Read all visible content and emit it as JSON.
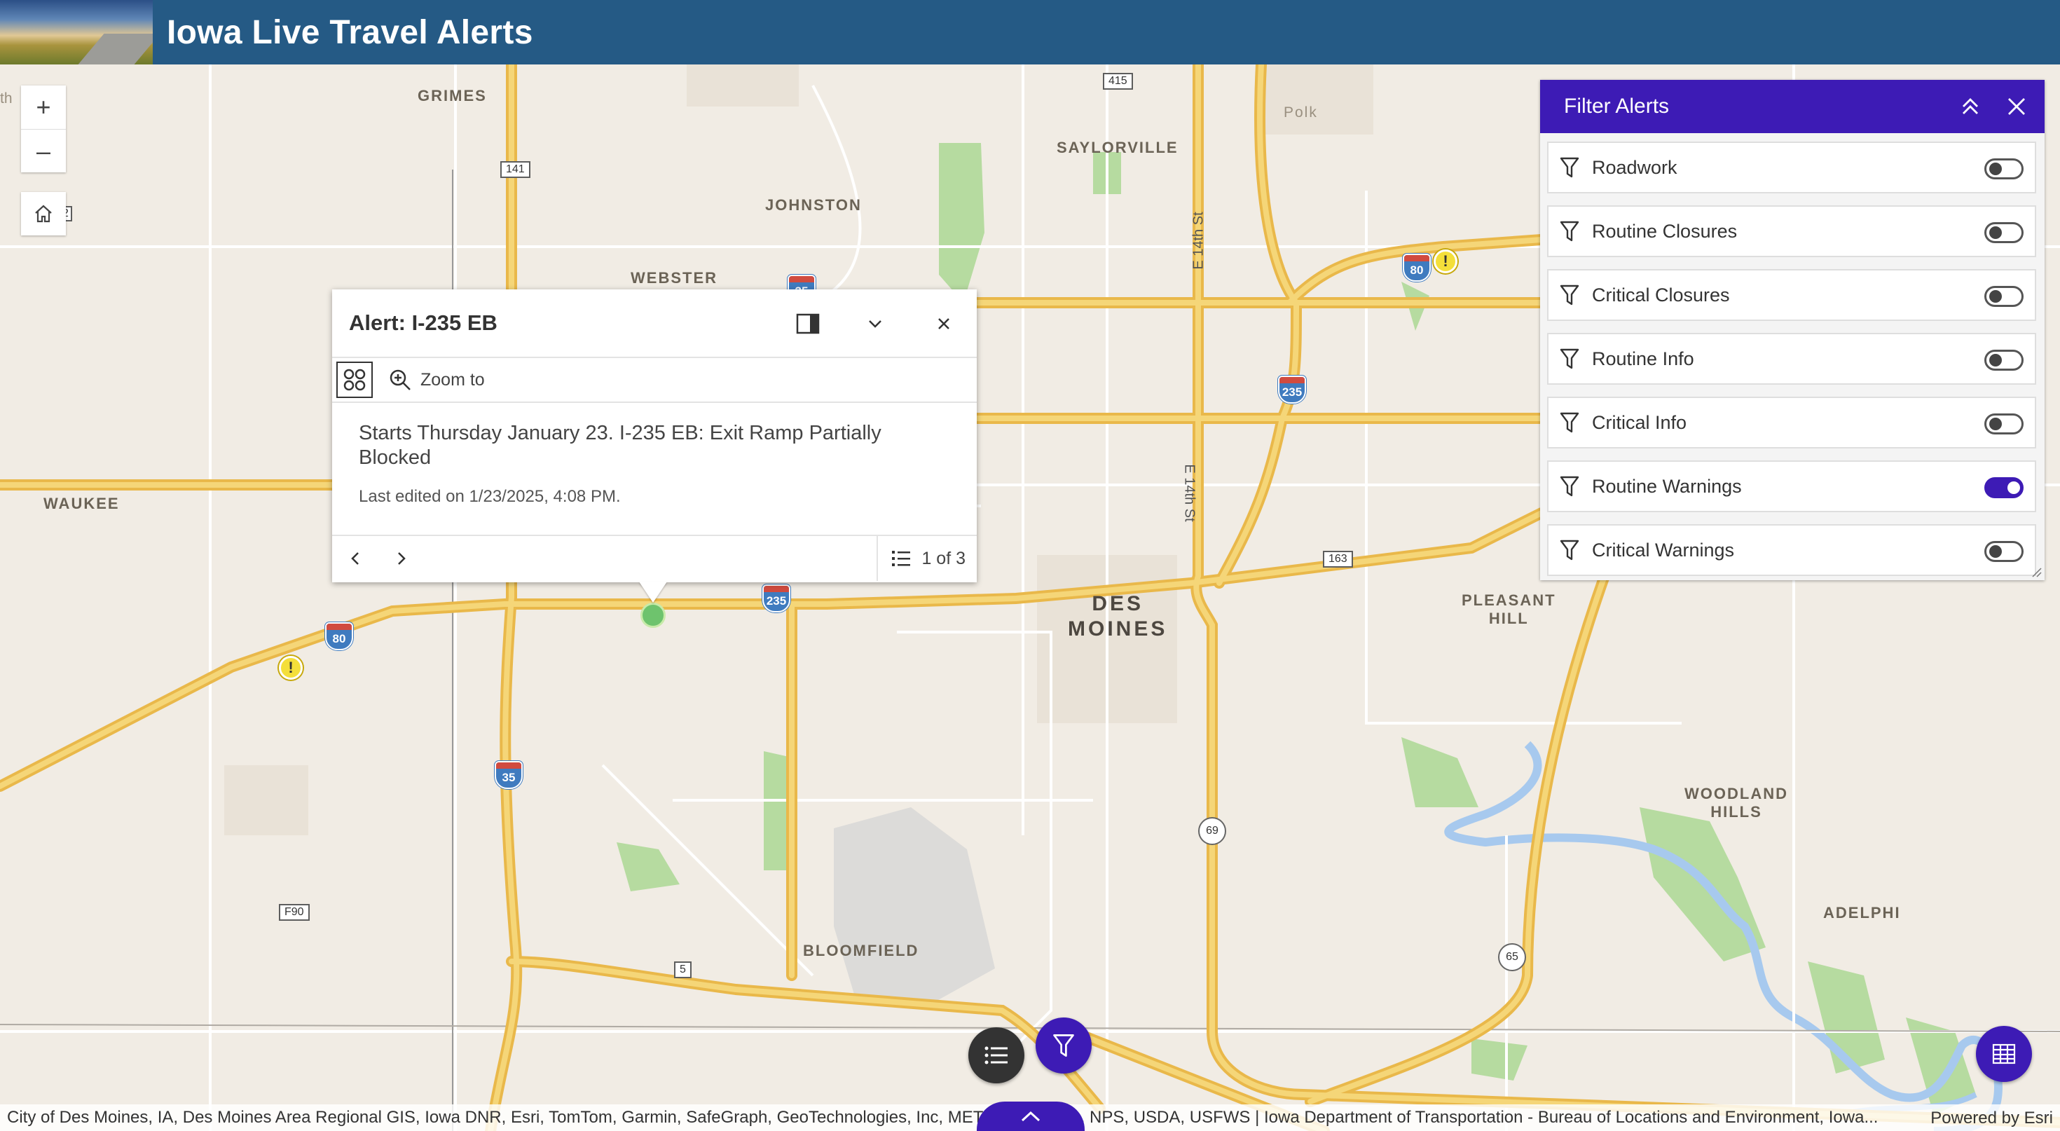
{
  "header": {
    "title": "Iowa Live Travel Alerts"
  },
  "map": {
    "places": {
      "grimes": "GRIMES",
      "saylorville": "SAYLORVILLE",
      "johnston": "JOHNSTON",
      "webster": "WEBSTER",
      "waukee": "WAUKEE",
      "des_moines": "DES\nMOINES",
      "pleasant_hill": "PLEASANT\nHILL",
      "woodland_hills": "WOODLAND\nHILLS",
      "adelphi": "ADELPHI",
      "bloomfield": "BLOOMFIELD",
      "polk": "Polk",
      "edge": "th"
    },
    "streets": {
      "e14": "E 14th St"
    },
    "shields": {
      "i80": "80",
      "i235": "235",
      "i35": "35",
      "us69": "69",
      "us65": "65",
      "r415": "415",
      "r141": "141",
      "r163": "163",
      "r5": "5",
      "f90": "F90",
      "r2": "2"
    }
  },
  "zoom": {
    "in": "+",
    "out": "–"
  },
  "popup": {
    "title": "Alert: I-235 EB",
    "zoom_to": "Zoom to",
    "description": "Starts Thursday January 23. I-235 EB: Exit Ramp Partially Blocked",
    "last_edited": "Last edited on 1/23/2025, 4:08 PM.",
    "pagination": "1 of 3"
  },
  "filter": {
    "title": "Filter Alerts",
    "items": [
      {
        "label": "Roadwork",
        "on": false
      },
      {
        "label": "Routine Closures",
        "on": false
      },
      {
        "label": "Critical Closures",
        "on": false
      },
      {
        "label": "Routine Info",
        "on": false
      },
      {
        "label": "Critical Info",
        "on": false
      },
      {
        "label": "Routine Warnings",
        "on": true
      },
      {
        "label": "Critical Warnings",
        "on": false
      }
    ]
  },
  "attribution": {
    "text": "City of Des Moines, IA, Des Moines Area Regional GIS, Iowa DNR, Esri, TomTom, Garmin, SafeGraph, GeoTechnologies, Inc, METI/NASA, EPA, NPS, USDA, USFWS | Iowa Department of Transportation - Bureau of Locations and Environment, Iowa...",
    "powered": "Powered by Esri"
  },
  "colors": {
    "header": "#255a85",
    "accent": "#3d1bb5",
    "road": "#f5c95a",
    "water": "#a7c9ee",
    "park": "#b6dba0"
  }
}
